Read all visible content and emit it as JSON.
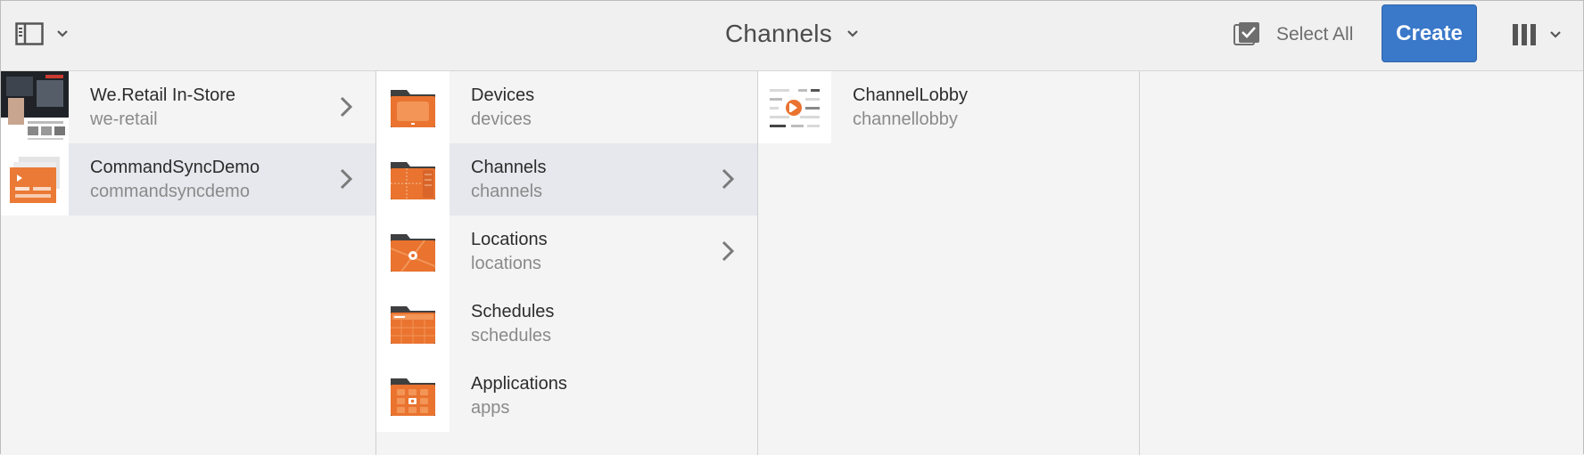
{
  "header": {
    "title": "Channels",
    "select_all_label": "Select All",
    "create_label": "Create"
  },
  "colors": {
    "accent": "#3a78c9",
    "folder_orange": "#e9732f",
    "active_row": "#e6e8ed"
  },
  "columns": [
    {
      "items": [
        {
          "title": "We.Retail In-Store",
          "name": "we-retail",
          "icon": "we-retail-thumbnail",
          "has_children": true,
          "selected": false
        },
        {
          "title": "CommandSyncDemo",
          "name": "commandsyncdemo",
          "icon": "commandsyncdemo-thumbnail",
          "has_children": true,
          "selected": true
        }
      ]
    },
    {
      "items": [
        {
          "title": "Devices",
          "name": "devices",
          "icon": "devices-folder-icon",
          "has_children": false,
          "selected": false
        },
        {
          "title": "Channels",
          "name": "channels",
          "icon": "channels-folder-icon",
          "has_children": true,
          "selected": true
        },
        {
          "title": "Locations",
          "name": "locations",
          "icon": "locations-folder-icon",
          "has_children": true,
          "selected": false
        },
        {
          "title": "Schedules",
          "name": "schedules",
          "icon": "schedules-folder-icon",
          "has_children": false,
          "selected": false
        },
        {
          "title": "Applications",
          "name": "apps",
          "icon": "applications-folder-icon",
          "has_children": false,
          "selected": false
        }
      ]
    },
    {
      "items": [
        {
          "title": "ChannelLobby",
          "name": "channellobby",
          "icon": "channel-lobby-icon",
          "has_children": false,
          "selected": false
        }
      ]
    }
  ]
}
